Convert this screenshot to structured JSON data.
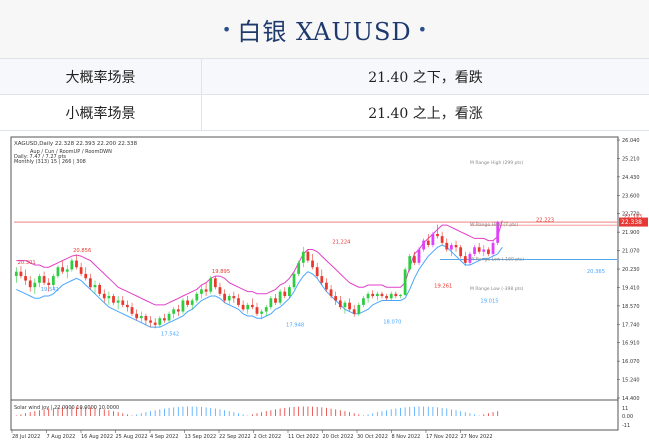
{
  "header": {
    "dot_left": "•",
    "title": "白银  XAUUSD",
    "dot_right": "•"
  },
  "scenarios": [
    {
      "label": "大概率场景",
      "value": "21.40 之下，看跌"
    },
    {
      "label": "小概率场景",
      "value": "21.40 之上，看涨"
    }
  ],
  "chart_info": {
    "symbol_line": "XAGUSD,Daily  22.328 22.393 22.200 22.338",
    "indicator_line1": "Aup / Cun / RoomUP / RoomDWN",
    "indicator_line2": "Daily: 7.47 / 7.27 pts",
    "indicator_line3": "Monthly (313) 15 | 266 | 308",
    "osc_label": "Solar wind joy  | 22.0000 10.0000 10.0000",
    "m_range_high": "M Range High (299 pts)",
    "w_range_high": "W Range High (7 pts)",
    "w_range_low": "W Range Low (-169 pts)",
    "m_range_low": "M Range Low (-398 pts)",
    "price_tag": "22.338"
  },
  "colors": {
    "bull": "#2ecc40",
    "bear": "#e8382f",
    "magenta": "#e040fb",
    "upper_line": "#e040c8",
    "lower_line": "#4aa6ff",
    "red_level": "#e53935",
    "blue_level": "#1e88e5"
  },
  "chart_data": {
    "type": "candlestick",
    "ylim": [
      14.4,
      26.04
    ],
    "y_ticks": [
      "26.040",
      "25.210",
      "24.430",
      "23.600",
      "22.770",
      "21.900",
      "21.070",
      "20.230",
      "19.410",
      "18.570",
      "17.740",
      "16.910",
      "16.070",
      "15.240",
      "14.400"
    ],
    "x_ticks": [
      "28 Jul 2022",
      "7 Aug 2022",
      "16 Aug 2022",
      "25 Aug 2022",
      "4 Sep 2022",
      "13 Sep 2022",
      "22 Sep 2022",
      "2 Oct 2022",
      "11 Oct 2022",
      "20 Oct 2022",
      "30 Oct 2022",
      "8 Nov 2022",
      "17 Nov 2022",
      "27 Nov 2022"
    ],
    "osc_ticks": [
      "11",
      "0.00",
      "-11"
    ],
    "price_labels": [
      {
        "text": "20.301",
        "value": 20.301,
        "index": 2,
        "color": "red"
      },
      {
        "text": "20.856",
        "value": 20.856,
        "index": 14,
        "color": "red"
      },
      {
        "text": "19.542",
        "value": 19.542,
        "index": 7,
        "color": "blue"
      },
      {
        "text": "17.542",
        "value": 17.542,
        "index": 33,
        "color": "blue"
      },
      {
        "text": "19.895",
        "value": 19.895,
        "index": 44,
        "color": "red"
      },
      {
        "text": "17.948",
        "value": 17.948,
        "index": 60,
        "color": "blue"
      },
      {
        "text": "21.224",
        "value": 21.224,
        "index": 70,
        "color": "red"
      },
      {
        "text": "18.070",
        "value": 18.07,
        "index": 81,
        "color": "blue"
      },
      {
        "text": "19.261",
        "value": 19.261,
        "index": 92,
        "color": "red"
      },
      {
        "text": "19.015",
        "value": 19.015,
        "index": 102,
        "color": "blue"
      },
      {
        "text": "22.223",
        "value": 22.223,
        "index": 114,
        "color": "red"
      },
      {
        "text": "20.365",
        "value": 20.365,
        "index": 125,
        "color": "blue"
      },
      {
        "text": "22.393",
        "value": 22.393,
        "index": 133,
        "color": "red"
      }
    ],
    "levels": {
      "m_range_high": 24.96,
      "w_range_high": 22.2,
      "w_range_low": 20.65,
      "m_range_low": 19.27,
      "current": 22.338
    },
    "candles": [
      [
        19.9,
        20.3,
        19.6,
        20.1
      ],
      [
        20.1,
        20.35,
        19.8,
        19.9
      ],
      [
        19.9,
        20.2,
        19.5,
        19.7
      ],
      [
        19.7,
        19.9,
        19.2,
        19.4
      ],
      [
        19.4,
        19.8,
        19.1,
        19.6
      ],
      [
        19.6,
        20.0,
        19.4,
        19.9
      ],
      [
        19.9,
        20.1,
        19.5,
        19.6
      ],
      [
        19.6,
        19.8,
        19.2,
        19.5
      ],
      [
        19.5,
        20.0,
        19.3,
        19.9
      ],
      [
        19.9,
        20.4,
        19.8,
        20.3
      ],
      [
        20.3,
        20.6,
        20.0,
        20.1
      ],
      [
        20.1,
        20.4,
        19.8,
        20.2
      ],
      [
        20.2,
        20.7,
        20.1,
        20.6
      ],
      [
        20.6,
        20.85,
        20.2,
        20.3
      ],
      [
        20.3,
        20.5,
        19.9,
        20.0
      ],
      [
        20.0,
        20.3,
        19.7,
        19.8
      ],
      [
        19.8,
        20.0,
        19.3,
        19.4
      ],
      [
        19.4,
        19.7,
        19.1,
        19.5
      ],
      [
        19.5,
        19.6,
        19.0,
        19.1
      ],
      [
        19.1,
        19.3,
        18.7,
        18.9
      ],
      [
        18.9,
        19.2,
        18.6,
        19.0
      ],
      [
        19.0,
        19.1,
        18.6,
        18.7
      ],
      [
        18.7,
        19.0,
        18.4,
        18.8
      ],
      [
        18.8,
        19.0,
        18.5,
        18.6
      ],
      [
        18.6,
        18.8,
        18.3,
        18.5
      ],
      [
        18.5,
        18.7,
        18.1,
        18.2
      ],
      [
        18.2,
        18.4,
        17.9,
        18.0
      ],
      [
        18.0,
        18.3,
        17.8,
        18.1
      ],
      [
        18.1,
        18.2,
        17.7,
        17.9
      ],
      [
        17.9,
        18.1,
        17.6,
        17.8
      ],
      [
        17.8,
        18.0,
        17.54,
        17.7
      ],
      [
        17.7,
        18.1,
        17.6,
        18.0
      ],
      [
        18.0,
        18.2,
        17.8,
        17.9
      ],
      [
        17.9,
        18.3,
        17.8,
        18.2
      ],
      [
        18.2,
        18.5,
        18.0,
        18.4
      ],
      [
        18.4,
        18.6,
        18.1,
        18.3
      ],
      [
        18.3,
        18.9,
        18.2,
        18.8
      ],
      [
        18.8,
        19.0,
        18.5,
        18.6
      ],
      [
        18.6,
        18.9,
        18.4,
        18.8
      ],
      [
        18.8,
        19.2,
        18.7,
        19.1
      ],
      [
        19.1,
        19.5,
        18.9,
        19.3
      ],
      [
        19.3,
        19.6,
        19.0,
        19.2
      ],
      [
        19.2,
        19.9,
        19.1,
        19.8
      ],
      [
        19.8,
        19.89,
        19.3,
        19.4
      ],
      [
        19.4,
        19.6,
        19.0,
        19.1
      ],
      [
        19.1,
        19.3,
        18.7,
        18.8
      ],
      [
        18.8,
        19.1,
        18.6,
        19.0
      ],
      [
        19.0,
        19.2,
        18.7,
        18.9
      ],
      [
        18.9,
        19.1,
        18.5,
        18.6
      ],
      [
        18.6,
        18.8,
        18.3,
        18.4
      ],
      [
        18.4,
        18.7,
        18.2,
        18.6
      ],
      [
        18.6,
        18.9,
        18.4,
        18.5
      ],
      [
        18.5,
        18.7,
        18.1,
        18.2
      ],
      [
        18.2,
        18.4,
        17.95,
        18.3
      ],
      [
        18.3,
        18.6,
        18.1,
        18.5
      ],
      [
        18.5,
        19.0,
        18.4,
        18.9
      ],
      [
        18.9,
        19.1,
        18.6,
        18.7
      ],
      [
        18.7,
        19.3,
        18.6,
        19.2
      ],
      [
        19.2,
        19.4,
        18.9,
        19.0
      ],
      [
        19.0,
        19.5,
        18.9,
        19.4
      ],
      [
        19.4,
        20.1,
        19.3,
        20.0
      ],
      [
        20.0,
        20.6,
        19.9,
        20.5
      ],
      [
        20.5,
        21.22,
        20.3,
        21.0
      ],
      [
        21.0,
        21.1,
        20.5,
        20.6
      ],
      [
        20.6,
        20.9,
        20.2,
        20.3
      ],
      [
        20.3,
        20.5,
        19.8,
        19.9
      ],
      [
        19.9,
        20.2,
        19.5,
        19.6
      ],
      [
        19.6,
        19.8,
        19.2,
        19.3
      ],
      [
        19.3,
        19.5,
        18.9,
        19.0
      ],
      [
        19.0,
        19.2,
        18.6,
        18.8
      ],
      [
        18.8,
        19.0,
        18.4,
        18.5
      ],
      [
        18.5,
        18.8,
        18.2,
        18.7
      ],
      [
        18.7,
        18.9,
        18.3,
        18.4
      ],
      [
        18.4,
        18.6,
        18.07,
        18.2
      ],
      [
        18.2,
        18.7,
        18.1,
        18.6
      ],
      [
        18.6,
        19.0,
        18.5,
        18.9
      ],
      [
        18.9,
        19.2,
        18.7,
        19.1
      ],
      [
        19.1,
        19.26,
        18.9,
        19.0
      ],
      [
        19.0,
        19.2,
        18.8,
        19.1
      ],
      [
        19.1,
        19.2,
        18.9,
        19.0
      ],
      [
        19.0,
        19.1,
        18.8,
        18.9
      ],
      [
        18.9,
        19.2,
        18.8,
        19.1
      ],
      [
        19.1,
        19.2,
        18.9,
        19.0
      ],
      [
        19.0,
        19.1,
        18.9,
        19.05
      ],
      [
        19.05,
        20.3,
        19.0,
        20.2
      ],
      [
        20.2,
        20.9,
        20.1,
        20.8
      ],
      [
        20.8,
        21.0,
        20.4,
        20.5
      ],
      [
        20.5,
        21.2,
        20.4,
        21.1
      ],
      [
        21.1,
        21.6,
        21.0,
        21.5
      ],
      [
        21.5,
        21.8,
        21.2,
        21.3
      ],
      [
        21.3,
        21.9,
        21.2,
        21.8
      ],
      [
        21.8,
        22.22,
        21.6,
        21.7
      ],
      [
        21.7,
        21.9,
        21.3,
        21.4
      ],
      [
        21.4,
        21.6,
        21.0,
        21.1
      ],
      [
        21.1,
        21.4,
        20.8,
        21.3
      ],
      [
        21.3,
        21.5,
        21.0,
        21.2
      ],
      [
        21.2,
        21.3,
        20.7,
        20.8
      ],
      [
        20.8,
        21.0,
        20.37,
        20.5
      ],
      [
        20.5,
        21.0,
        20.4,
        20.9
      ],
      [
        20.9,
        21.3,
        20.8,
        21.2
      ],
      [
        21.2,
        21.4,
        20.9,
        21.0
      ],
      [
        21.0,
        21.3,
        20.8,
        21.1
      ],
      [
        21.1,
        21.2,
        20.8,
        20.9
      ],
      [
        20.9,
        21.5,
        20.8,
        21.4
      ],
      [
        21.4,
        22.39,
        21.3,
        22.338
      ]
    ],
    "upper_line": [
      20.6,
      20.6,
      20.6,
      20.5,
      20.4,
      20.4,
      20.3,
      20.3,
      20.4,
      20.5,
      20.6,
      20.7,
      20.8,
      20.85,
      20.8,
      20.7,
      20.6,
      20.4,
      20.2,
      20.0,
      19.8,
      19.6,
      19.4,
      19.3,
      19.2,
      19.1,
      19.0,
      18.9,
      18.8,
      18.7,
      18.6,
      18.6,
      18.6,
      18.7,
      18.8,
      18.9,
      19.0,
      19.1,
      19.2,
      19.3,
      19.5,
      19.6,
      19.8,
      19.9,
      19.9,
      19.8,
      19.6,
      19.5,
      19.4,
      19.3,
      19.2,
      19.2,
      19.1,
      19.1,
      19.1,
      19.2,
      19.3,
      19.5,
      19.6,
      19.8,
      20.1,
      20.5,
      20.9,
      21.1,
      21.1,
      21.0,
      20.8,
      20.6,
      20.4,
      20.2,
      20.0,
      19.8,
      19.6,
      19.5,
      19.4,
      19.4,
      19.5,
      19.5,
      19.5,
      19.5,
      19.4,
      19.4,
      19.4,
      19.4,
      19.6,
      20.3,
      20.9,
      21.1,
      21.4,
      21.6,
      21.8,
      22.0,
      22.2,
      22.2,
      22.1,
      22.0,
      21.9,
      21.8,
      21.7,
      21.6,
      21.6,
      21.6,
      21.5,
      21.5,
      21.7,
      22.4
    ],
    "lower_line": [
      19.3,
      19.2,
      19.1,
      19.0,
      18.9,
      18.9,
      19.0,
      19.0,
      19.1,
      19.3,
      19.5,
      19.6,
      19.7,
      19.8,
      19.7,
      19.5,
      19.3,
      19.1,
      18.9,
      18.7,
      18.5,
      18.4,
      18.3,
      18.2,
      18.1,
      18.0,
      17.9,
      17.8,
      17.7,
      17.6,
      17.6,
      17.6,
      17.7,
      17.8,
      17.9,
      18.0,
      18.1,
      18.3,
      18.4,
      18.6,
      18.8,
      18.9,
      19.0,
      19.0,
      18.9,
      18.7,
      18.6,
      18.5,
      18.4,
      18.2,
      18.1,
      18.1,
      18.0,
      18.0,
      18.1,
      18.2,
      18.4,
      18.5,
      18.7,
      18.9,
      19.2,
      19.6,
      19.9,
      20.1,
      20.0,
      19.8,
      19.5,
      19.2,
      19.0,
      18.8,
      18.6,
      18.4,
      18.3,
      18.2,
      18.2,
      18.3,
      18.4,
      18.6,
      18.7,
      18.8,
      18.8,
      18.8,
      18.8,
      18.8,
      18.9,
      19.3,
      19.8,
      20.2,
      20.5,
      20.8,
      21.0,
      21.2,
      21.3,
      21.2,
      21.0,
      20.8,
      20.6,
      20.4,
      20.4,
      20.5,
      20.6,
      20.7,
      20.7,
      20.8,
      20.9,
      21.2
    ]
  }
}
